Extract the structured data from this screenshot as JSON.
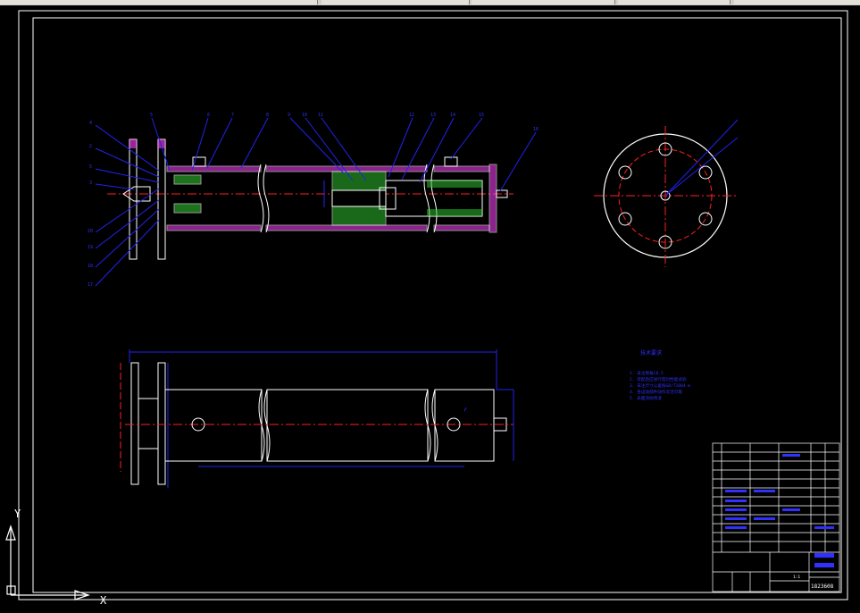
{
  "drawing": {
    "part_numbers_left": [
      "4",
      "2",
      "5",
      "3",
      "20",
      "19",
      "18",
      "17"
    ],
    "part_numbers_top": [
      "5",
      "6",
      "7",
      "8",
      "9",
      "10",
      "11",
      "12",
      "13",
      "14",
      "15",
      "16"
    ],
    "section_notes_label": "技术要求",
    "notes": [
      "1. 未注倒角C0.5",
      "2. 装配后应进行密封性能试验",
      "3. 未注尺寸公差按GB/T1804-m",
      "4. 各运动部件动作灵活可靠",
      "5. 表面涂防锈漆"
    ],
    "drawing_number": "1823608",
    "scale": "1:1",
    "ucs": {
      "x_label": "X",
      "y_label": "Y"
    }
  },
  "colors": {
    "background": "#000000",
    "outline": "#ffffff",
    "hatch": "#ff40ff",
    "green_hatch": "#30c030",
    "dimension": "#2222ee",
    "centerline": "#ff2020",
    "title_text": "#3030ff"
  }
}
